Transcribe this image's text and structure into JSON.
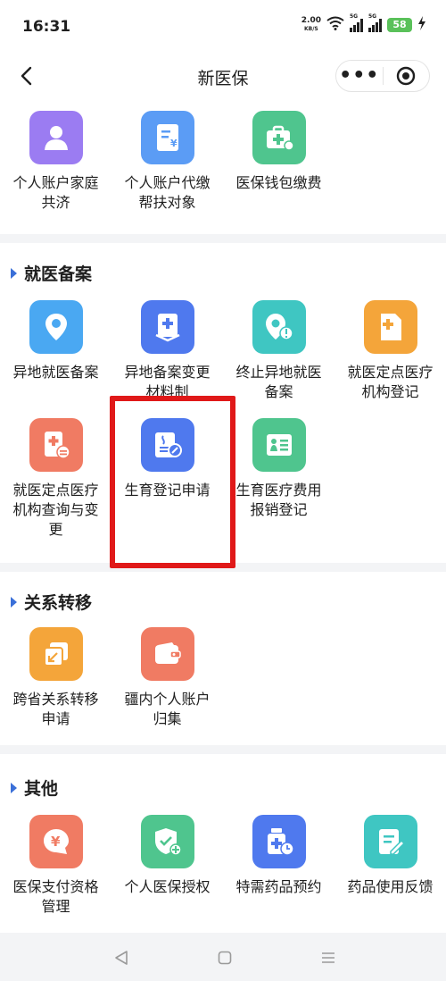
{
  "status_bar": {
    "time": "16:31",
    "net_speed_value": "2.00",
    "net_speed_unit": "KB/S",
    "signal_tag_1": "5G",
    "signal_tag_2": "5G",
    "battery": "58",
    "icons": [
      "wifi-icon",
      "signal-icon",
      "battery-icon",
      "charging-icon"
    ]
  },
  "nav": {
    "title": "新医保",
    "back_icon": "chevron-left-icon",
    "more_label": "•••",
    "close_icon": "target-icon"
  },
  "sections": [
    {
      "title": "",
      "items": [
        {
          "label": "个人账户家庭\n共济",
          "icon": "family-user-icon",
          "color": "#9b7cf2"
        },
        {
          "label": "个人账户代缴\n帮扶对象",
          "icon": "invoice-yuan-icon",
          "color": "#5b9cf5"
        },
        {
          "label": "医保钱包缴费",
          "icon": "medical-wallet-icon",
          "color": "#4fc58e"
        }
      ]
    },
    {
      "title": "就医备案",
      "items": [
        {
          "label": "异地就医备案",
          "icon": "location-pin-icon",
          "color": "#4aa8f2"
        },
        {
          "label": "异地备案变更\n材料制",
          "icon": "medical-doc-icon",
          "color": "#4f79ee"
        },
        {
          "label": "终止异地就医\n备案",
          "icon": "location-stop-icon",
          "color": "#3fc6c2"
        },
        {
          "label": "就医定点医疗\n机构登记",
          "icon": "hospital-file-icon",
          "color": "#f4a53a"
        },
        {
          "label": "就医定点医疗\n机构查询与变\n更",
          "icon": "hospital-query-icon",
          "color": "#f07b63"
        },
        {
          "label": "生育登记申请",
          "icon": "birth-register-icon",
          "color": "#4f79ee"
        },
        {
          "label": "生育医疗费用\n报销登记",
          "icon": "birth-expense-icon",
          "color": "#4fc58e"
        }
      ]
    },
    {
      "title": "关系转移",
      "items": [
        {
          "label": "跨省关系转移\n申请",
          "icon": "transfer-icon",
          "color": "#f4a53a"
        },
        {
          "label": "疆内个人账户\n归集",
          "icon": "wallet-icon",
          "color": "#f07b63"
        }
      ]
    },
    {
      "title": "其他",
      "items": [
        {
          "label": "医保支付资格\n管理",
          "icon": "yuan-bubble-icon",
          "color": "#f07b63"
        },
        {
          "label": "个人医保授权",
          "icon": "shield-check-icon",
          "color": "#4fc58e"
        },
        {
          "label": "特需药品预约",
          "icon": "medicine-clock-icon",
          "color": "#4f79ee"
        },
        {
          "label": "药品使用反馈",
          "icon": "feedback-edit-icon",
          "color": "#3fc6c2"
        }
      ]
    }
  ],
  "highlight_color": "#e01919",
  "bottom_nav": {
    "icons": [
      "back-triangle-icon",
      "home-square-icon",
      "menu-lines-icon"
    ]
  }
}
